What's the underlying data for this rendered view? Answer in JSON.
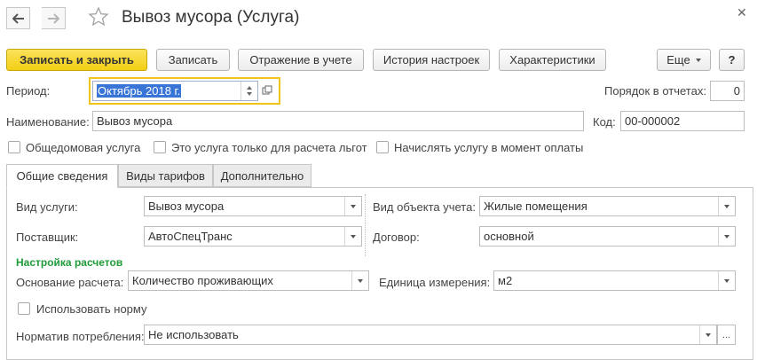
{
  "window": {
    "title": "Вывоз мусора (Услуга)",
    "back_icon": "arrow-left-icon",
    "forward_icon": "arrow-right-icon",
    "favorite_icon": "star-icon",
    "close_glyph": "✕"
  },
  "toolbar": {
    "save_close": "Записать и закрыть",
    "save": "Записать",
    "accounting": "Отражение в учете",
    "history": "История настроек",
    "characteristics": "Характеристики",
    "more": "Еще",
    "help": "?"
  },
  "form": {
    "period_label": "Период:",
    "period_value": "Октябрь 2018 г.",
    "report_order_label": "Порядок в отчетах:",
    "report_order_value": "0",
    "name_label": "Наименование:",
    "name_value": "Вывоз мусора",
    "code_label": "Код:",
    "code_value": "00-000002",
    "cb_common": "Общедомовая услуга",
    "cb_benefits": "Это услуга только для расчета льгот",
    "cb_payment": "Начислять услугу в момент оплаты"
  },
  "tabs": [
    "Общие сведения",
    "Виды тарифов",
    "Дополнительно"
  ],
  "general": {
    "service_type_label": "Вид услуги:",
    "service_type_value": "Вывоз мусора",
    "object_type_label": "Вид объекта учета:",
    "object_type_value": "Жилые помещения",
    "supplier_label": "Поставщик:",
    "supplier_value": "АвтоСпецТранс",
    "contract_label": "Договор:",
    "contract_value": "основной",
    "calc_settings_title": "Настройка расчетов",
    "calc_basis_label": "Основание расчета:",
    "calc_basis_value": "Количество проживающих",
    "unit_label": "Единица измерения:",
    "unit_value": "м2",
    "use_norm_label": "Использовать норму",
    "norm_label": "Норматив потребления:",
    "norm_value": "Не использовать"
  },
  "colors": {
    "primary_button": "#f3cf16",
    "section_title": "#1f9b38",
    "focus_border": "#f0c419",
    "selection": "#3875d7"
  }
}
